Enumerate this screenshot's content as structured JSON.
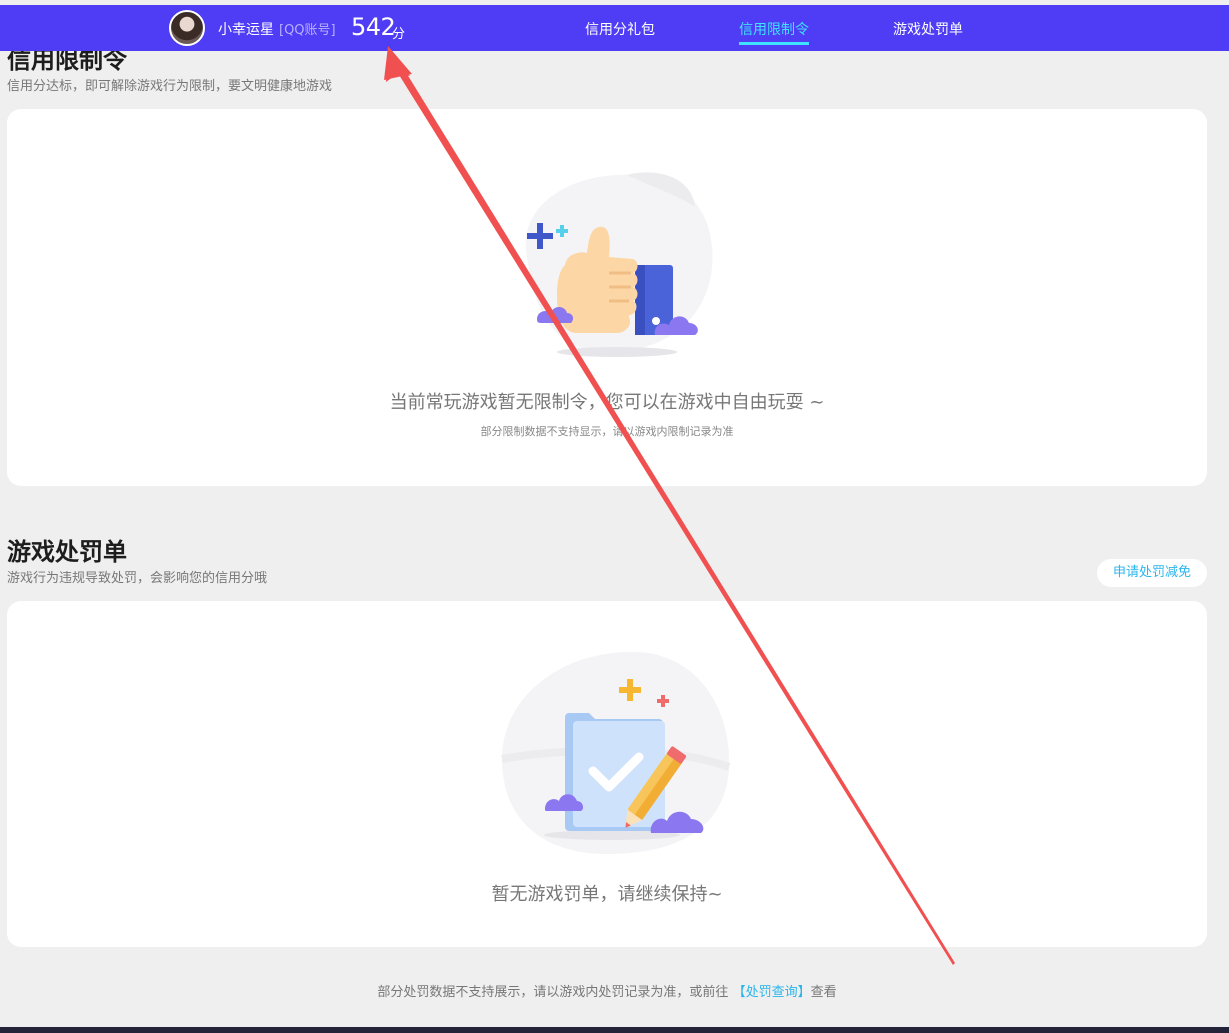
{
  "header": {
    "username": "小幸运星",
    "account_type": "[QQ账号]",
    "score": "542",
    "score_unit": "分",
    "tabs": [
      {
        "label": "信用分礼包",
        "active": false
      },
      {
        "label": "信用限制令",
        "active": true
      },
      {
        "label": "游戏处罚单",
        "active": false
      }
    ]
  },
  "restriction": {
    "title": "信用限制令",
    "subtitle": "信用分达标，即可解除游戏行为限制，要文明健康地游戏",
    "empty_text": "当前常玩游戏暂无限制令，您可以在游戏中自由玩耍 ~",
    "empty_note": "部分限制数据不支持显示，请以游戏内限制记录为准"
  },
  "penalty": {
    "title": "游戏处罚单",
    "subtitle": "游戏行为违规导致处罚，会影响您的信用分哦",
    "appeal_button": "申请处罚减免",
    "empty_text": "暂无游戏罚单，请继续保持~"
  },
  "footer": {
    "note_prefix": "部分处罚数据不支持展示，请以游戏内处罚记录为准，或前往",
    "link": "【处罚查询】",
    "note_suffix": "查看"
  },
  "colors": {
    "nav_bg": "#4f3cf5",
    "active_tab": "#3fe2ff",
    "link": "#2ab5ec",
    "annotation_arrow": "#f05050"
  }
}
